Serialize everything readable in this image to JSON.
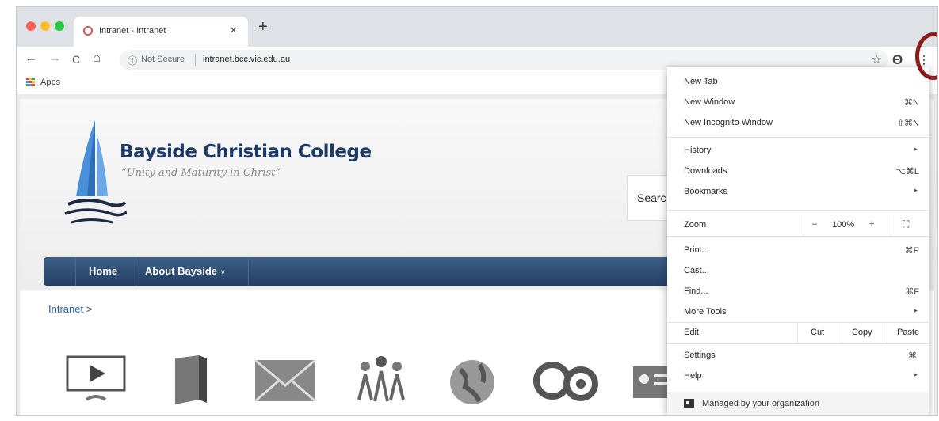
{
  "browser": {
    "tab": {
      "title": "Intranet - Intranet",
      "close": "×",
      "favicon": "bcc-favicon"
    },
    "new_tab": "+",
    "nav": {
      "back": "←",
      "forward": "→",
      "reload": "C",
      "home": "⌂"
    },
    "omnibox": {
      "info_icon": "ⓘ",
      "security": "Not Secure",
      "url": "intranet.bcc.vic.edu.au",
      "star": "☆"
    },
    "profile_glyph": "Θ",
    "menu_glyph": "⋮",
    "bookmarks": {
      "apps_label": "Apps"
    }
  },
  "site": {
    "title": "Bayside Christian College",
    "tagline": "“Unity and Maturity in Christ”",
    "search_label": "Searc",
    "nav": {
      "home": "Home",
      "about": "About Bayside",
      "about_chevron": "∨"
    },
    "breadcrumb": {
      "link": "Intranet",
      "sep": ">"
    },
    "apps": [
      {
        "icon": "video-icon"
      },
      {
        "icon": "book-icon"
      },
      {
        "icon": "mail-icon"
      },
      {
        "icon": "people-icon"
      },
      {
        "icon": "globe-icon"
      },
      {
        "icon": "owl-icon"
      },
      {
        "icon": "id-card-icon"
      }
    ]
  },
  "menu": {
    "new_tab": "New Tab",
    "new_window": {
      "label": "New Window",
      "shortcut": "⌘N"
    },
    "incognito": {
      "label": "New Incognito Window",
      "shortcut": "⇧⌘N"
    },
    "history": "History",
    "downloads": {
      "label": "Downloads",
      "shortcut": "⌥⌘L"
    },
    "bookmarks": "Bookmarks",
    "zoom": {
      "label": "Zoom",
      "minus": "–",
      "value": "100%",
      "plus": "+",
      "fullscreen": "⛶"
    },
    "print": {
      "label": "Print...",
      "shortcut": "⌘P"
    },
    "cast": "Cast...",
    "find": {
      "label": "Find...",
      "shortcut": "⌘F"
    },
    "more_tools": "More Tools",
    "edit": {
      "label": "Edit",
      "cut": "Cut",
      "copy": "Copy",
      "paste": "Paste"
    },
    "settings": {
      "label": "Settings",
      "shortcut": "⌘,"
    },
    "help": "Help",
    "managed": "Managed by your organization",
    "submenu_arrow": "▸"
  },
  "colors": {
    "annotation_ring": "#8b1a1a",
    "nav_bar": "#233f63",
    "title_blue": "#1c3a66",
    "link_blue": "#2a5da8"
  }
}
